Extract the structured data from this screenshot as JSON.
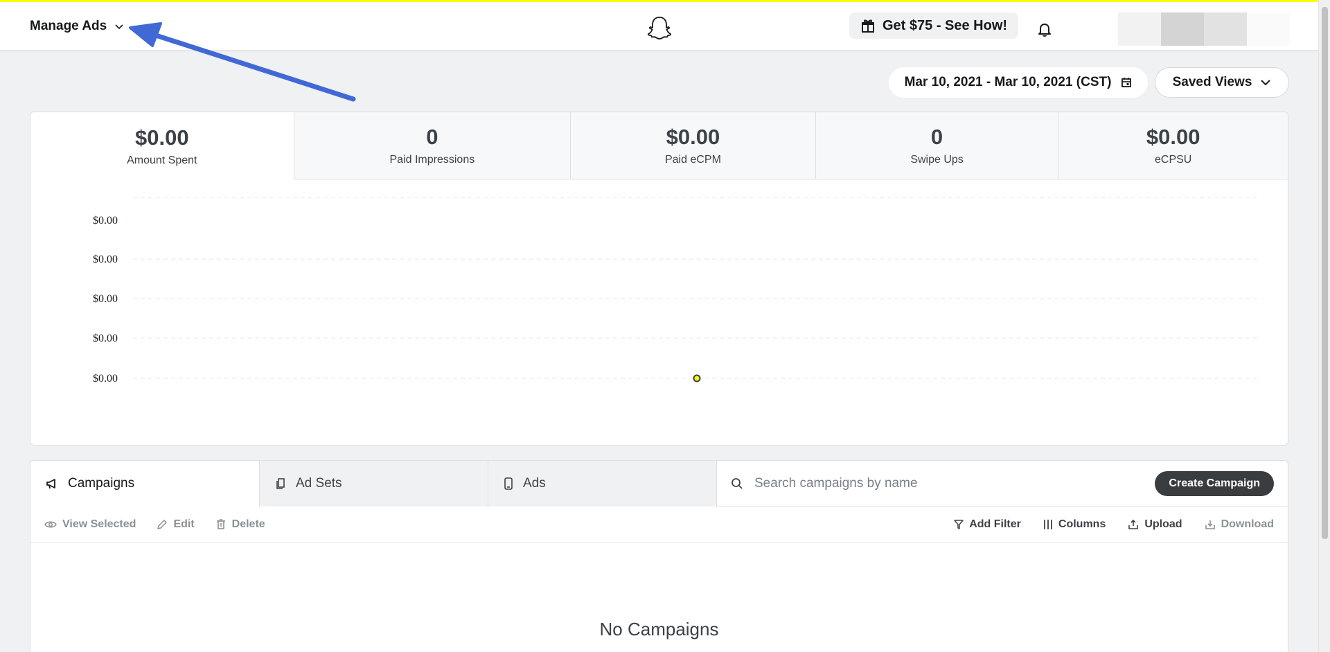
{
  "header": {
    "menu_label": "Manage Ads",
    "promo_label": "Get $75 - See How!"
  },
  "controls": {
    "date_range": "Mar 10, 2021 - Mar 10, 2021 (CST)",
    "saved_views": "Saved Views"
  },
  "metrics": [
    {
      "value": "$0.00",
      "label": "Amount Spent"
    },
    {
      "value": "0",
      "label": "Paid Impressions"
    },
    {
      "value": "$0.00",
      "label": "Paid eCPM"
    },
    {
      "value": "0",
      "label": "Swipe Ups"
    },
    {
      "value": "$0.00",
      "label": "eCPSU"
    }
  ],
  "chart_data": {
    "type": "line",
    "y_tick_labels": [
      "$0.00",
      "$0.00",
      "$0.00",
      "$0.00",
      "$0.00"
    ],
    "series": [
      {
        "values": [
          0
        ]
      }
    ],
    "point_color": "#fffc00",
    "grid": true
  },
  "tabs": [
    {
      "label": "Campaigns"
    },
    {
      "label": "Ad Sets"
    },
    {
      "label": "Ads"
    }
  ],
  "search": {
    "placeholder": "Search campaigns by name"
  },
  "create_button": "Create Campaign",
  "toolbar": {
    "view_selected": "View Selected",
    "edit": "Edit",
    "delete": "Delete",
    "add_filter": "Add Filter",
    "columns": "Columns",
    "upload": "Upload",
    "download": "Download"
  },
  "empty_state": "No Campaigns",
  "colors": {
    "accent_yellow": "#fffc00",
    "arrow_blue": "#4169d6"
  }
}
